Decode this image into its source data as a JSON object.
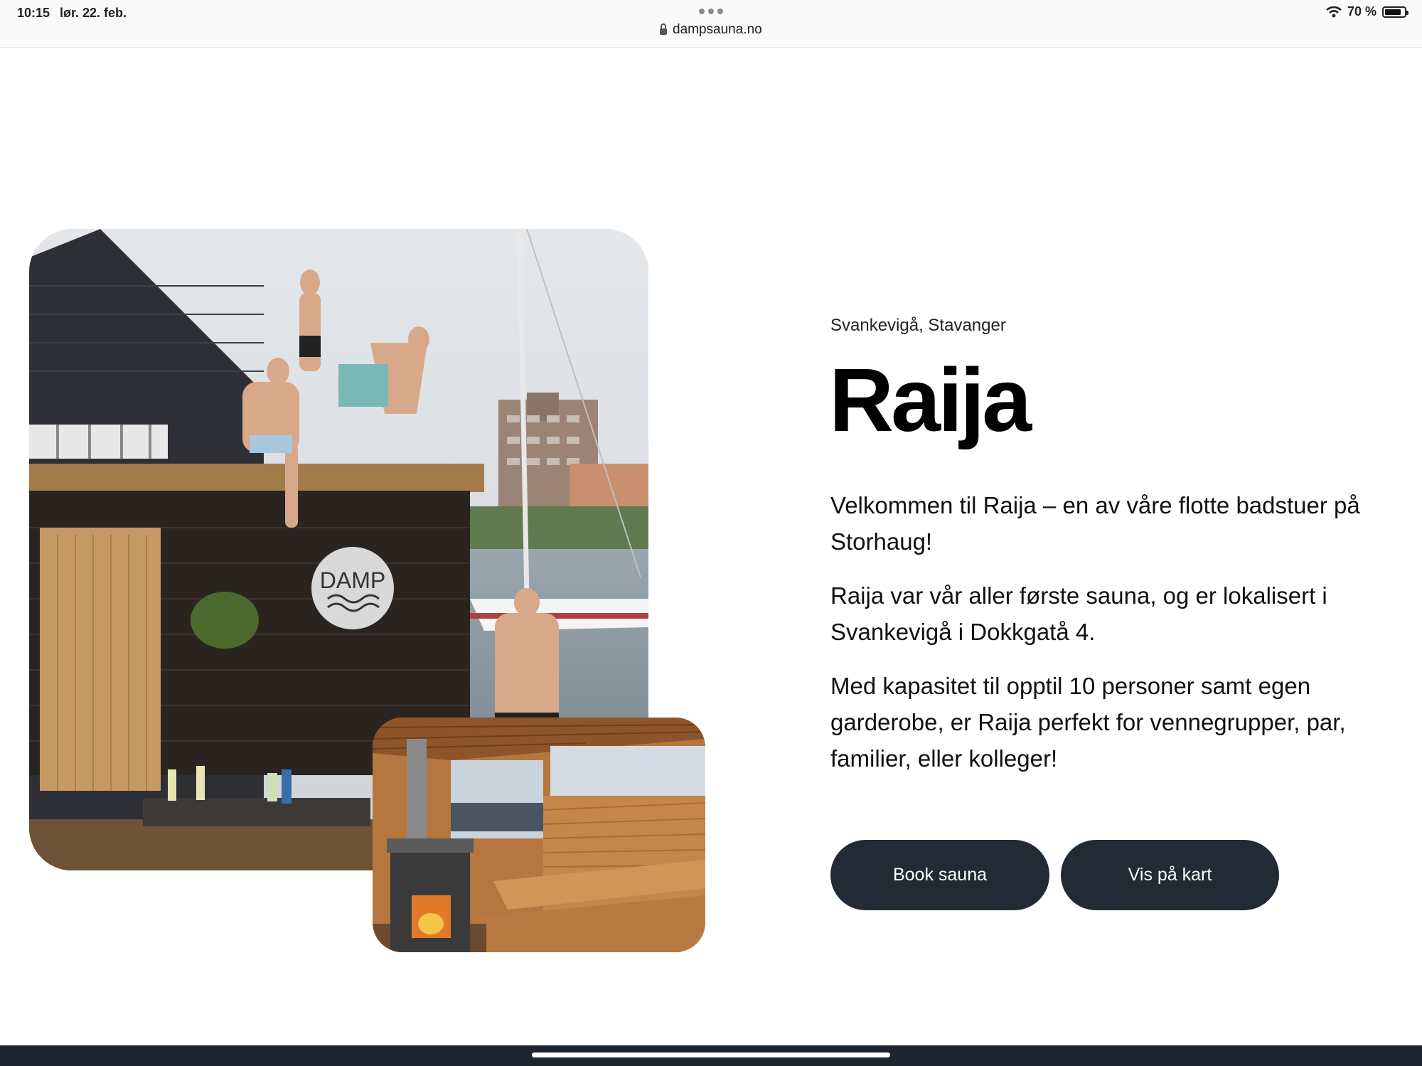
{
  "status_bar": {
    "time": "10:15",
    "date": "lør. 22. feb.",
    "url": "dampsauna.no",
    "battery": "70 %",
    "battery_level": 0.7
  },
  "hero": {
    "location": "Svankevigå, Stavanger",
    "title": "Raija",
    "paragraphs": [
      "Velkommen til Raija – en av våre flotte badstuer på Storhaug!",
      "Raija var vår aller første sauna, og er lokalisert i Svankevigå i Dokkgatå 4.",
      "Med kapasitet til opptil 10 personer samt egen garderobe, er Raija perfekt for vennegrupper, par, familier, eller kolleger!"
    ],
    "buttons": {
      "book": "Book sauna",
      "map": "Vis på kart"
    },
    "logo_text": "DAMP"
  },
  "colors": {
    "button_bg": "#222a35",
    "bottom_bar": "#1f2530"
  }
}
